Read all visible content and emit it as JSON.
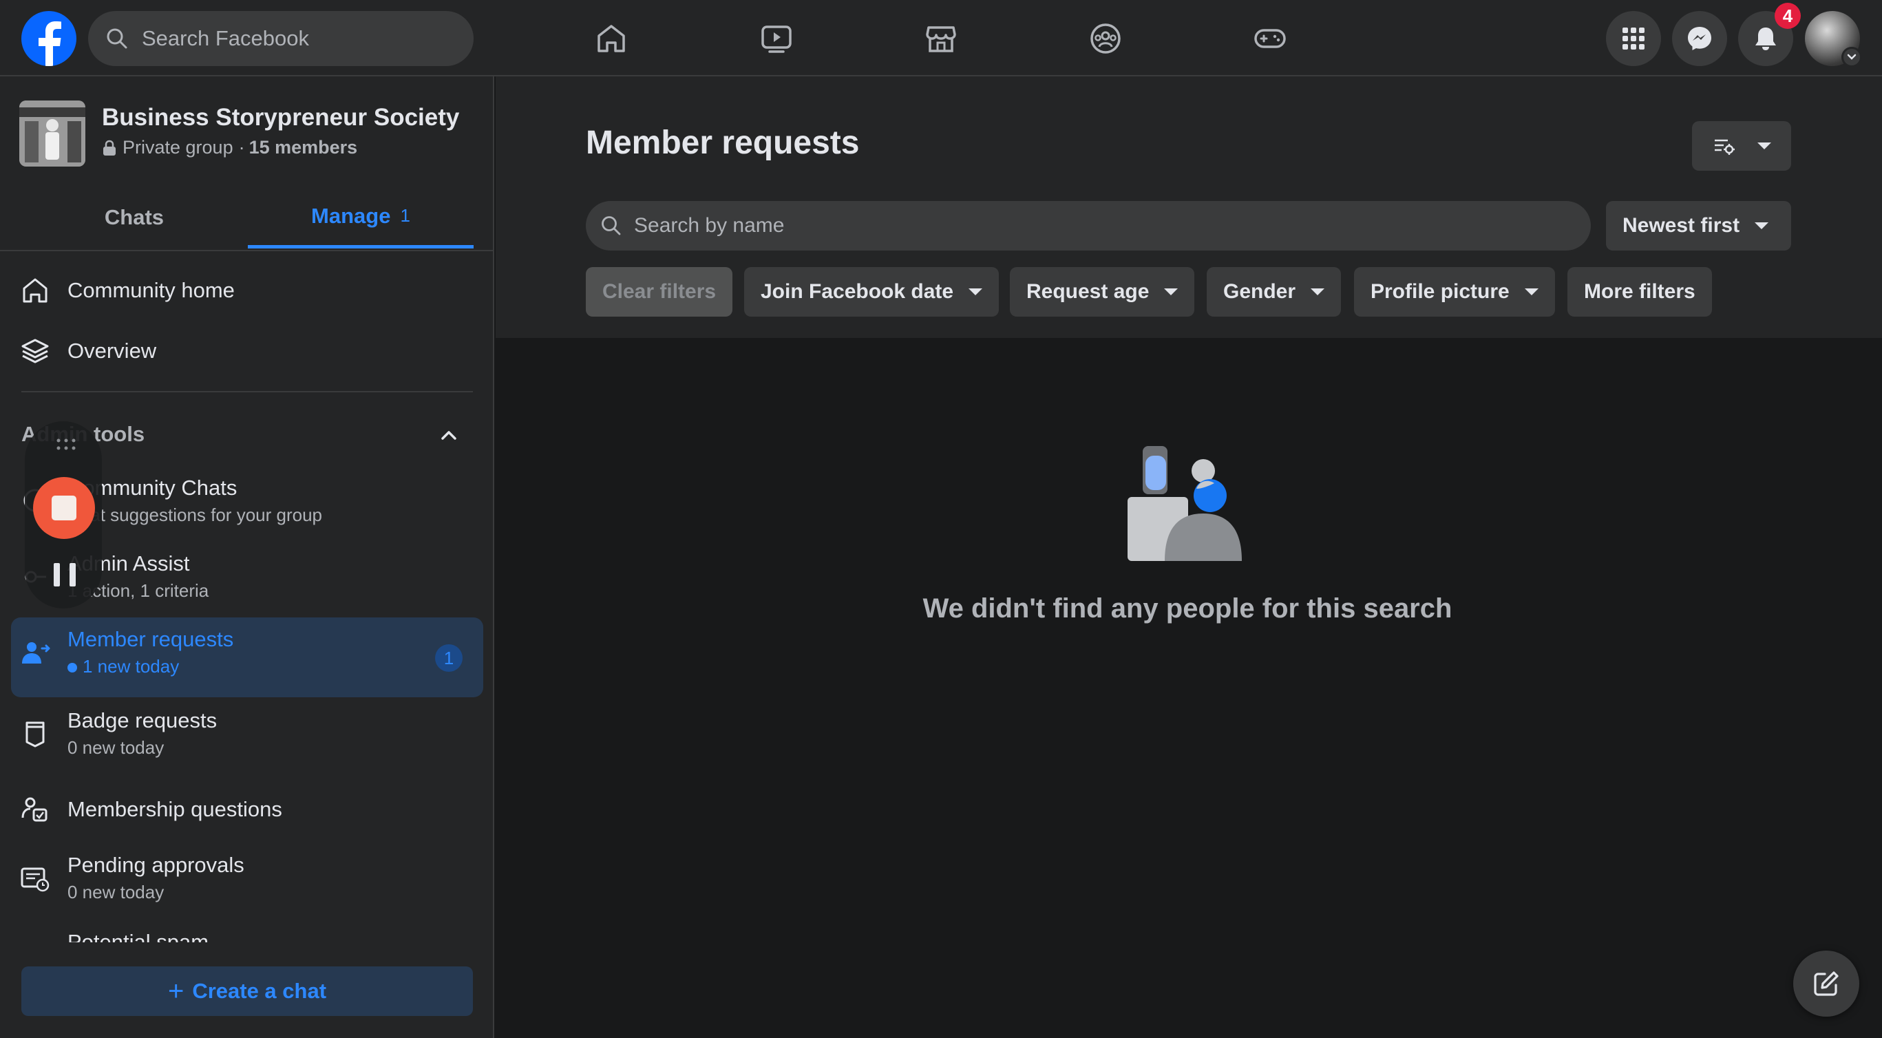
{
  "topbar": {
    "logo_icon": "facebook-logo-icon",
    "search_placeholder": "Search Facebook",
    "nav_icons": [
      "home-icon",
      "video-icon",
      "marketplace-icon",
      "groups-icon",
      "gaming-icon"
    ],
    "right_icons": [
      "menu-grid-icon",
      "messenger-icon",
      "notifications-icon"
    ],
    "notifications_count": "4",
    "brand_color": "#0866ff",
    "badge_color": "#e41e3f"
  },
  "sidebar": {
    "group_name": "Business Storypreneur Society",
    "group_privacy": "Private group",
    "group_separator": "·",
    "group_members": "15 members",
    "tabs": [
      {
        "label": "Chats"
      },
      {
        "label": "Manage",
        "count": "1"
      }
    ],
    "nav": [
      {
        "label": "Community home",
        "icon": "home-outline-icon"
      },
      {
        "label": "Overview",
        "icon": "layers-icon"
      }
    ],
    "section_title": "Admin tools",
    "admin_items": [
      {
        "label": "Community Chats",
        "sub": "Chat suggestions for your group",
        "icon": "chat-icon"
      },
      {
        "label": "Admin Assist",
        "sub": "1 action, 1 criteria",
        "icon": "admin-assist-icon"
      },
      {
        "label": "Member requests",
        "sub": "1 new today",
        "badge": "1",
        "icon": "add-person-icon"
      },
      {
        "label": "Badge requests",
        "sub": "0 new today",
        "icon": "badge-icon"
      },
      {
        "label": "Membership questions",
        "icon": "questions-icon"
      },
      {
        "label": "Pending approvals",
        "sub": "0 new today",
        "icon": "pending-icon"
      },
      {
        "label": "Potential spam"
      }
    ],
    "create_chat": {
      "plus": "+",
      "label": "Create a chat"
    },
    "accent_color": "#2d88ff"
  },
  "main": {
    "title": "Member requests",
    "search_placeholder": "Search by name",
    "sort_label": "Newest first",
    "filters": [
      {
        "label": "Clear filters",
        "disabled": true
      },
      {
        "label": "Join Facebook date"
      },
      {
        "label": "Request age"
      },
      {
        "label": "Gender"
      },
      {
        "label": "Profile picture"
      },
      {
        "label": "More filters"
      }
    ],
    "empty_message": "We didn't find any people for this search"
  }
}
